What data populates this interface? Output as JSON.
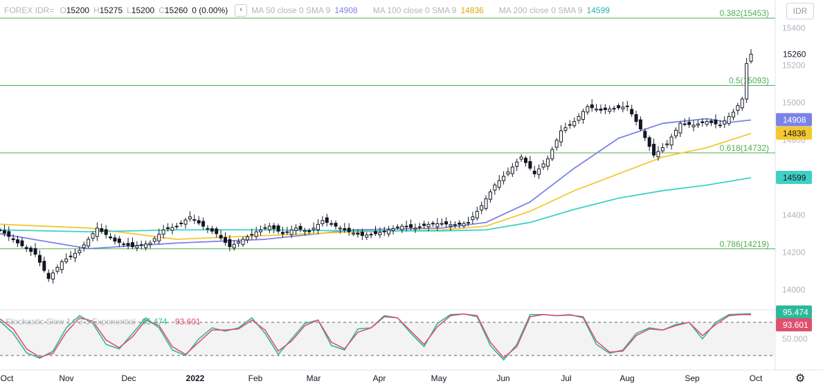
{
  "symbol_button": "IDR",
  "legend": {
    "symbol": "FOREX IDR=",
    "o_label": "O",
    "o_value": "15200",
    "h_label": "H",
    "h_value": "15275",
    "l_label": "L",
    "l_value": "15200",
    "c_label": "C",
    "c_value": "15260",
    "change": "0 (0.00%)",
    "ma50_label": "MA 50 close 0 SMA 9",
    "ma50_value": "14908",
    "ma100_label": "MA 100 close 0 SMA 9",
    "ma100_value": "14836",
    "ma200_label": "MA 200 close 0 SMA 9",
    "ma200_value": "14599"
  },
  "stoch_legend": {
    "label": "Stochastic Slow 14 3 3 Exponential",
    "k_value": "95.474",
    "d_value": "93.601"
  },
  "colors": {
    "ma50": "#7b83e8",
    "ma100": "#f5c830",
    "ma200": "#3dd1c3",
    "fib": "#4caf50",
    "stoch_k": "#2bb99a",
    "stoch_d": "#e0506e",
    "candle": "#131722"
  },
  "chart_data": [
    {
      "type": "candlestick",
      "title": "FOREX IDR=",
      "y_axis_ticks": [
        14000,
        14200,
        14400,
        14600,
        14800,
        15000,
        15200,
        15400
      ],
      "ylim": [
        13900,
        15520
      ],
      "x_axis_labels": [
        "Oct",
        "Nov",
        "Dec",
        "2022",
        "Feb",
        "Mar",
        "Apr",
        "May",
        "Jun",
        "Jul",
        "Aug",
        "Sep",
        "Oct"
      ],
      "last_price": 15260,
      "fibonacci_levels": [
        {
          "label": "0.382(15453)",
          "value": 15453
        },
        {
          "label": "0.5(15093)",
          "value": 15093
        },
        {
          "label": "0.618(14732)",
          "value": 14732
        },
        {
          "label": "0.786(14219)",
          "value": 14219
        }
      ],
      "price_path": [
        [
          0,
          14320
        ],
        [
          4,
          14250
        ],
        [
          8,
          14190
        ],
        [
          11,
          14060
        ],
        [
          14,
          14150
        ],
        [
          18,
          14210
        ],
        [
          22,
          14330
        ],
        [
          26,
          14260
        ],
        [
          30,
          14230
        ],
        [
          34,
          14250
        ],
        [
          37,
          14320
        ],
        [
          40,
          14340
        ],
        [
          43,
          14390
        ],
        [
          46,
          14340
        ],
        [
          49,
          14300
        ],
        [
          52,
          14230
        ],
        [
          55,
          14270
        ],
        [
          58,
          14310
        ],
        [
          61,
          14340
        ],
        [
          64,
          14300
        ],
        [
          67,
          14330
        ],
        [
          70,
          14310
        ],
        [
          73,
          14370
        ],
        [
          76,
          14340
        ],
        [
          79,
          14310
        ],
        [
          82,
          14290
        ],
        [
          85,
          14300
        ],
        [
          88,
          14320
        ],
        [
          91,
          14340
        ],
        [
          94,
          14330
        ],
        [
          97,
          14350
        ],
        [
          100,
          14355
        ],
        [
          103,
          14345
        ],
        [
          106,
          14360
        ],
        [
          109,
          14450
        ],
        [
          112,
          14560
        ],
        [
          115,
          14630
        ],
        [
          118,
          14710
        ],
        [
          121,
          14620
        ],
        [
          124,
          14700
        ],
        [
          127,
          14850
        ],
        [
          130,
          14900
        ],
        [
          133,
          14980
        ],
        [
          136,
          14960
        ],
        [
          139,
          14970
        ],
        [
          142,
          14980
        ],
        [
          145,
          14860
        ],
        [
          148,
          14720
        ],
        [
          151,
          14780
        ],
        [
          154,
          14890
        ],
        [
          157,
          14880
        ],
        [
          160,
          14900
        ],
        [
          163,
          14880
        ],
        [
          166,
          14950
        ],
        [
          168,
          15020
        ],
        [
          169,
          15210
        ],
        [
          170,
          15260
        ]
      ],
      "series": [
        {
          "name": "MA 50 close 0 SMA 9",
          "last": 14908,
          "values": [
            [
              0,
              14300
            ],
            [
              20,
              14220
            ],
            [
              40,
              14250
            ],
            [
              60,
              14270
            ],
            [
              80,
              14320
            ],
            [
              100,
              14330
            ],
            [
              110,
              14360
            ],
            [
              120,
              14470
            ],
            [
              130,
              14650
            ],
            [
              140,
              14810
            ],
            [
              150,
              14890
            ],
            [
              160,
              14915
            ],
            [
              165,
              14895
            ],
            [
              170,
              14908
            ]
          ]
        },
        {
          "name": "MA 100 close 0 SMA 9",
          "last": 14836,
          "values": [
            [
              0,
              14350
            ],
            [
              20,
              14330
            ],
            [
              40,
              14270
            ],
            [
              60,
              14290
            ],
            [
              80,
              14310
            ],
            [
              100,
              14320
            ],
            [
              110,
              14340
            ],
            [
              120,
              14420
            ],
            [
              130,
              14530
            ],
            [
              140,
              14620
            ],
            [
              150,
              14710
            ],
            [
              160,
              14760
            ],
            [
              170,
              14836
            ]
          ]
        },
        {
          "name": "MA 200 close 0 SMA 9",
          "last": 14599,
          "values": [
            [
              0,
              14320
            ],
            [
              20,
              14310
            ],
            [
              40,
              14320
            ],
            [
              60,
              14320
            ],
            [
              80,
              14315
            ],
            [
              100,
              14315
            ],
            [
              110,
              14320
            ],
            [
              120,
              14360
            ],
            [
              130,
              14430
            ],
            [
              140,
              14490
            ],
            [
              150,
              14530
            ],
            [
              160,
              14560
            ],
            [
              170,
              14599
            ]
          ]
        }
      ]
    },
    {
      "type": "line",
      "title": "Stochastic Slow 14 3 3 Exponential",
      "y_axis_ticks": [
        50
      ],
      "y_tick_label": "50.000",
      "ylim": [
        0,
        100
      ],
      "reference_lines": [
        80,
        20
      ],
      "series": [
        {
          "name": "K",
          "last": 95.474,
          "values": [
            [
              0,
              82
            ],
            [
              3,
              60
            ],
            [
              6,
              25
            ],
            [
              9,
              15
            ],
            [
              12,
              28
            ],
            [
              15,
              70
            ],
            [
              18,
              92
            ],
            [
              21,
              78
            ],
            [
              24,
              40
            ],
            [
              27,
              32
            ],
            [
              30,
              60
            ],
            [
              33,
              88
            ],
            [
              36,
              70
            ],
            [
              39,
              30
            ],
            [
              42,
              20
            ],
            [
              45,
              50
            ],
            [
              48,
              70
            ],
            [
              51,
              64
            ],
            [
              54,
              70
            ],
            [
              57,
              88
            ],
            [
              60,
              60
            ],
            [
              63,
              22
            ],
            [
              66,
              50
            ],
            [
              69,
              78
            ],
            [
              72,
              84
            ],
            [
              75,
              38
            ],
            [
              78,
              30
            ],
            [
              81,
              68
            ],
            [
              84,
              70
            ],
            [
              87,
              92
            ],
            [
              90,
              88
            ],
            [
              93,
              60
            ],
            [
              96,
              36
            ],
            [
              99,
              78
            ],
            [
              102,
              94
            ],
            [
              105,
              95
            ],
            [
              108,
              90
            ],
            [
              111,
              38
            ],
            [
              114,
              12
            ],
            [
              117,
              40
            ],
            [
              120,
              94
            ],
            [
              123,
              94
            ],
            [
              126,
              92
            ],
            [
              129,
              94
            ],
            [
              132,
              88
            ],
            [
              135,
              40
            ],
            [
              138,
              24
            ],
            [
              141,
              30
            ],
            [
              144,
              60
            ],
            [
              147,
              70
            ],
            [
              150,
              66
            ],
            [
              153,
              76
            ],
            [
              156,
              80
            ],
            [
              159,
              50
            ],
            [
              162,
              80
            ],
            [
              165,
              94
            ],
            [
              168,
              95
            ],
            [
              170,
              95.474
            ]
          ]
        },
        {
          "name": "D",
          "last": 93.601,
          "values": [
            [
              0,
              86
            ],
            [
              3,
              68
            ],
            [
              6,
              32
            ],
            [
              9,
              17
            ],
            [
              12,
              24
            ],
            [
              15,
              62
            ],
            [
              18,
              88
            ],
            [
              21,
              82
            ],
            [
              24,
              48
            ],
            [
              27,
              34
            ],
            [
              30,
              54
            ],
            [
              33,
              84
            ],
            [
              36,
              74
            ],
            [
              39,
              36
            ],
            [
              42,
              22
            ],
            [
              45,
              44
            ],
            [
              48,
              66
            ],
            [
              51,
              66
            ],
            [
              54,
              68
            ],
            [
              57,
              84
            ],
            [
              60,
              66
            ],
            [
              63,
              28
            ],
            [
              66,
              46
            ],
            [
              69,
              74
            ],
            [
              72,
              84
            ],
            [
              75,
              44
            ],
            [
              78,
              32
            ],
            [
              81,
              62
            ],
            [
              84,
              70
            ],
            [
              87,
              90
            ],
            [
              90,
              88
            ],
            [
              93,
              64
            ],
            [
              96,
              40
            ],
            [
              99,
              72
            ],
            [
              102,
              92
            ],
            [
              105,
              95
            ],
            [
              108,
              92
            ],
            [
              111,
              44
            ],
            [
              114,
              16
            ],
            [
              117,
              36
            ],
            [
              120,
              90
            ],
            [
              123,
              94
            ],
            [
              126,
              92
            ],
            [
              129,
              93
            ],
            [
              132,
              90
            ],
            [
              135,
              46
            ],
            [
              138,
              26
            ],
            [
              141,
              28
            ],
            [
              144,
              56
            ],
            [
              147,
              68
            ],
            [
              150,
              66
            ],
            [
              153,
              74
            ],
            [
              156,
              80
            ],
            [
              159,
              56
            ],
            [
              162,
              76
            ],
            [
              165,
              92
            ],
            [
              168,
              94
            ],
            [
              170,
              93.601
            ]
          ]
        }
      ]
    }
  ]
}
